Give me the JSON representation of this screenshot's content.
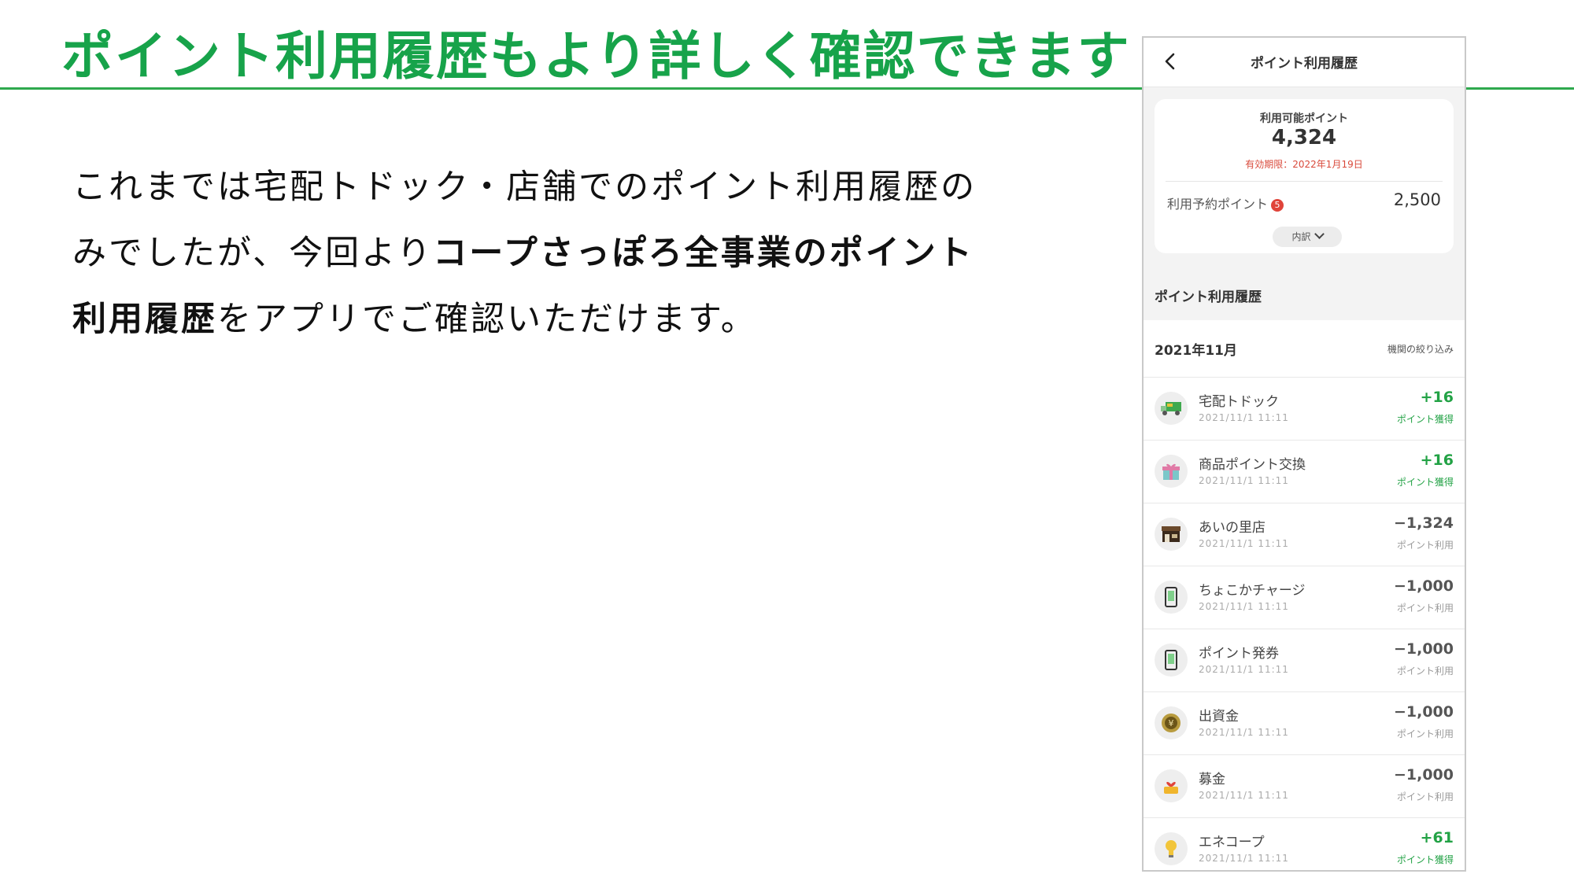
{
  "slide": {
    "title": "ポイント利用履歴もより詳しく確認できます",
    "body": {
      "l1": "これまでは宅配トドック・店舗でのポイント利用履歴の",
      "l2a": "みでしたが、今回より",
      "l2b": "コープさっぽろ全事業のポイント",
      "l3a": "利用履歴",
      "l3b": "をアプリでご確認いただけます。"
    }
  },
  "app": {
    "header_title": "ポイント利用履歴",
    "card": {
      "available_label": "利用可能ポイント",
      "available_value": "4,324",
      "expiry": "有効期限：2022年1月19日",
      "reserved_label": "利用予約ポイント",
      "reserved_badge": "5",
      "reserved_value": "2,500",
      "breakdown_label": "内訳"
    },
    "history_title": "ポイント利用履歴",
    "month": "2021年11月",
    "filter_label": "機関の絞り込み",
    "transactions": [
      {
        "name": "宅配トドック",
        "date": "2021/11/1  11:11",
        "amount": "+16",
        "kind": "ポイント獲得",
        "icon": "truck-icon"
      },
      {
        "name": "商品ポイント交換",
        "date": "2021/11/1  11:11",
        "amount": "+16",
        "kind": "ポイント獲得",
        "icon": "gift-icon"
      },
      {
        "name": "あいの里店",
        "date": "2021/11/1  11:11",
        "amount": "−1,324",
        "kind": "ポイント利用",
        "icon": "store-icon"
      },
      {
        "name": "ちょこかチャージ",
        "date": "2021/11/1  11:11",
        "amount": "−1,000",
        "kind": "ポイント利用",
        "icon": "smartphone-icon"
      },
      {
        "name": "ポイント発券",
        "date": "2021/11/1  11:11",
        "amount": "−1,000",
        "kind": "ポイント利用",
        "icon": "smartphone-icon"
      },
      {
        "name": "出資金",
        "date": "2021/11/1  11:11",
        "amount": "−1,000",
        "kind": "ポイント利用",
        "icon": "yen-coin-icon"
      },
      {
        "name": "募金",
        "date": "2021/11/1  11:11",
        "amount": "−1,000",
        "kind": "ポイント利用",
        "icon": "donation-icon"
      },
      {
        "name": "エネコープ",
        "date": "2021/11/1  11:11",
        "amount": "+61",
        "kind": "ポイント獲得",
        "icon": "lightbulb-icon"
      }
    ],
    "colors": {
      "accent_green": "#17a34a",
      "earn_green": "#22a245",
      "expiry_red": "#d94a3b"
    }
  }
}
